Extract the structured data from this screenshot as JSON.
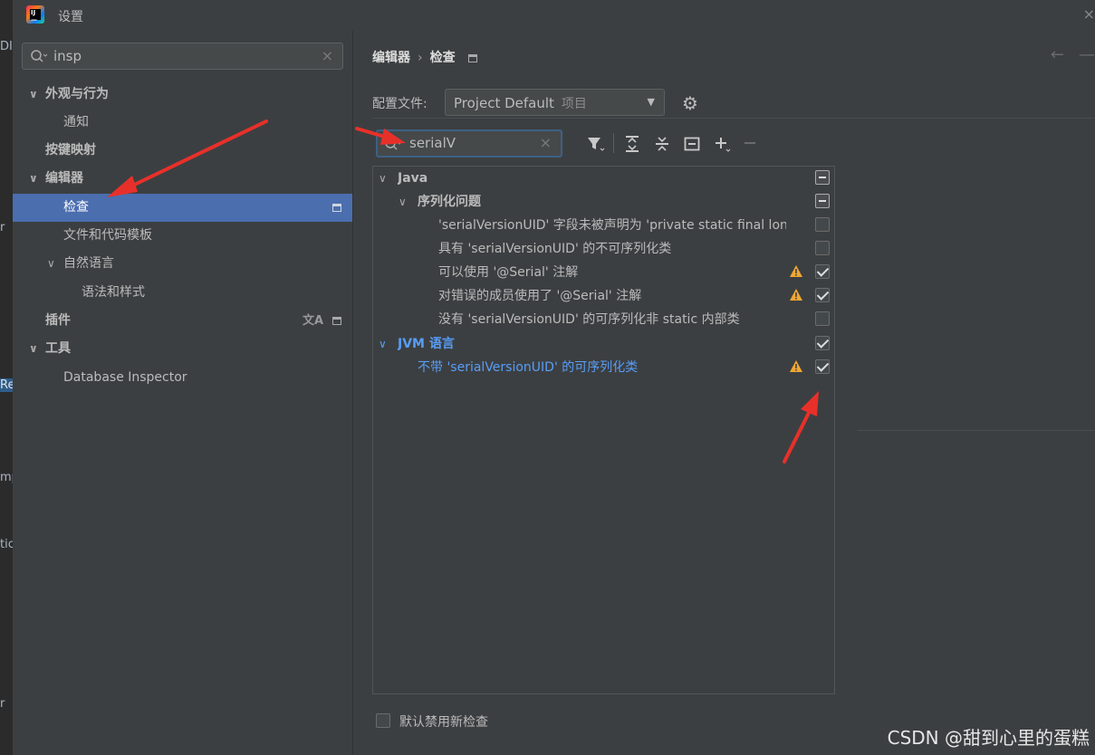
{
  "window": {
    "title": "设置"
  },
  "background_fragments": [
    "DI",
    "r",
    "Re",
    "mp",
    "tic",
    "r"
  ],
  "sidebar": {
    "search": {
      "value": "insp"
    },
    "items": [
      {
        "label": "外观与行为"
      },
      {
        "label": "通知"
      },
      {
        "label": "按键映射"
      },
      {
        "label": "编辑器"
      },
      {
        "label": "检查"
      },
      {
        "label": "文件和代码模板"
      },
      {
        "label": "自然语言"
      },
      {
        "label": "语法和样式"
      },
      {
        "label": "插件"
      },
      {
        "label": "工具"
      },
      {
        "label": "Database Inspector"
      }
    ]
  },
  "main": {
    "breadcrumb": [
      "编辑器",
      "检查"
    ],
    "profile": {
      "label": "配置文件:",
      "name": "Project Default",
      "scope": "项目"
    },
    "inspection_search": {
      "value": "serialV"
    },
    "tree": [
      {
        "label": "Java",
        "state": "mixed"
      },
      {
        "label": "序列化问题",
        "state": "mixed"
      },
      {
        "label": "'serialVersionUID' 字段未被声明为 'private static final long'",
        "state": "unchecked",
        "warning": false
      },
      {
        "label": "具有 'serialVersionUID' 的不可序列化类",
        "state": "unchecked",
        "warning": false
      },
      {
        "label": "可以使用 '@Serial' 注解",
        "state": "checked",
        "warning": true
      },
      {
        "label": "对错误的成员使用了 '@Serial' 注解",
        "state": "checked",
        "warning": true
      },
      {
        "label": "没有 'serialVersionUID' 的可序列化非 static 内部类",
        "state": "unchecked",
        "warning": false
      },
      {
        "label": "JVM 语言",
        "state": "checked"
      },
      {
        "label": "不带 'serialVersionUID' 的可序列化类",
        "state": "checked",
        "warning": true
      }
    ],
    "footer": {
      "checkbox_label": "默认禁用新检查",
      "checked": false
    }
  },
  "watermark": "CSDN @甜到心里的蛋糕",
  "colors": {
    "selection": "#4b6eaf",
    "link_blue": "#589df6",
    "warning": "#f0a732",
    "annotation_arrow": "#e8302a"
  }
}
